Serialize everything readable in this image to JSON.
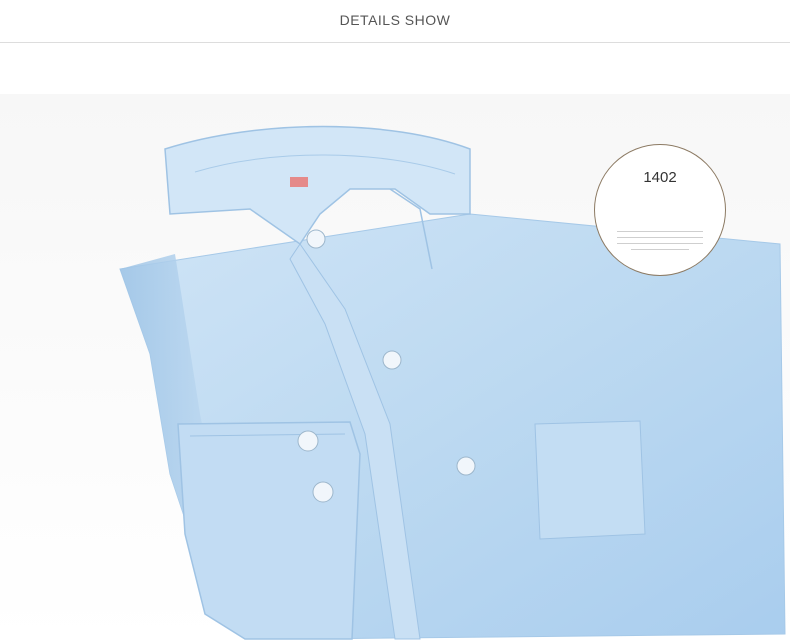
{
  "header": {
    "title": "DETAILS SHOW"
  },
  "badge": {
    "code": "1402"
  },
  "colors": {
    "shirt": "#bcd9f1",
    "accent": "#8c7a63",
    "rule": "#dddddd"
  }
}
